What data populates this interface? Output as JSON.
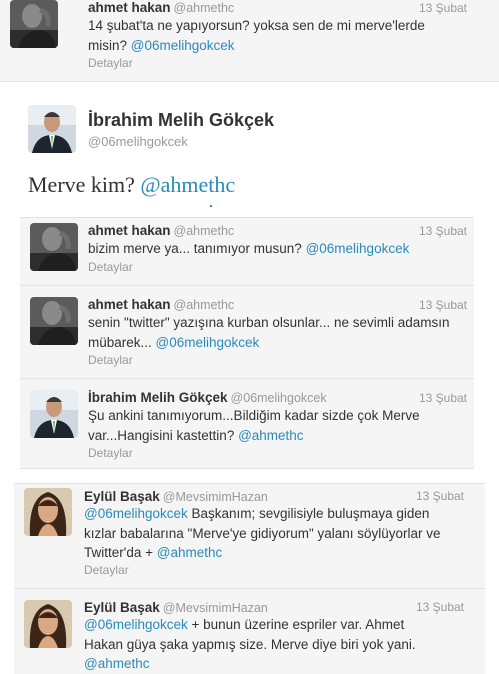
{
  "top_tweet": {
    "name": "ahmet hakan",
    "handle": "@ahmethc",
    "time": "13 Şubat",
    "text_lines": [
      "14 şubat'ta ne yapıyorsun? yoksa sen de mi merve'lerde",
      "misin? "
    ],
    "mention": "@06melihgokcek",
    "details": "Detaylar"
  },
  "main_tweet": {
    "name": "İbrahim Melih Gökçek",
    "handle": "@06melihgokcek",
    "text": "Merve kim? ",
    "mention": "@ahmethc"
  },
  "replies": [
    {
      "name": "ahmet hakan",
      "handle": "@ahmethc",
      "time": "13 Şubat",
      "line1": "bizim merve ya... tanımıyor musun? ",
      "mention": "@06melihgokcek",
      "details": "Detaylar"
    },
    {
      "name": "ahmet hakan",
      "handle": "@ahmethc",
      "time": "13 Şubat",
      "line1": "senin \"twitter\" yazışına kurban olsunlar... ne sevimli adamsın",
      "line2": "mübarek... ",
      "mention": "@06melihgokcek",
      "details": "Detaylar"
    },
    {
      "name": "İbrahim Melih Gökçek",
      "handle": "@06melihgokcek",
      "time": "13 Şubat",
      "line1": "Şu ankini tanımıyorum...Bildiğim kadar sizde çok Merve",
      "line2": "var...Hangisini kastettin? ",
      "mention": "@ahmethc",
      "details": "Detaylar"
    }
  ],
  "bottom": [
    {
      "name": "Eylül Başak",
      "handle": "@MevsimimHazan",
      "time": "13 Şubat",
      "mention_start": "@06melihgokcek",
      "line1_rest": " Başkanım; sevgilisiyle buluşmaya giden",
      "line2": "kızlar babalarına \"Merve'ye gidiyorum\" yalanı söylüyorlar ve",
      "line3": "Twitter'da + ",
      "mention_end": "@ahmethc",
      "details": "Detaylar"
    },
    {
      "name": "Eylül Başak",
      "handle": "@MevsimimHazan",
      "time": "13 Şubat",
      "mention_start": "@06melihgokcek",
      "line1_rest": " + bunun üzerine espriler var. Ahmet",
      "line2": "Hakan güya şaka yapmış size. Merve diye biri yok yani.",
      "mention_end": "@ahmethc"
    }
  ]
}
